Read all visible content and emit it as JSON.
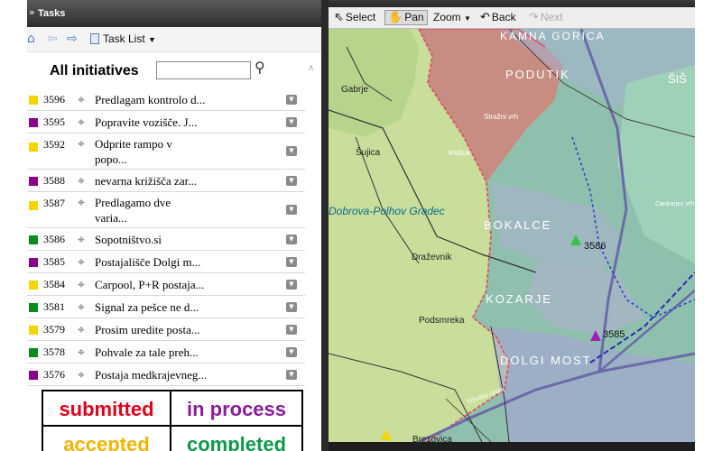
{
  "panel": {
    "title": "Tasks"
  },
  "toolbar": {
    "tasklist_label": "Task List"
  },
  "heading": "All initiatives",
  "search": {
    "value": ""
  },
  "tasks": [
    {
      "id": "3596",
      "text": "Predlagam kontrolo d...",
      "color": "#f3d500"
    },
    {
      "id": "3595",
      "text": "Popravite vozišče. J...",
      "color": "#8a008a"
    },
    {
      "id": "3592",
      "text": "Odprite rampo v popo...",
      "color": "#f3d500"
    },
    {
      "id": "3588",
      "text": "nevarna križišča zar...",
      "color": "#8a008a"
    },
    {
      "id": "3587",
      "text": "Predlagamo dve varia...",
      "color": "#f3d500"
    },
    {
      "id": "3586",
      "text": "Sopotništvo.si",
      "color": "#0a8a1a"
    },
    {
      "id": "3585",
      "text": "Postajališče Dolgi m...",
      "color": "#8a008a"
    },
    {
      "id": "3584",
      "text": "Carpool, P+R postaja...",
      "color": "#f3d500"
    },
    {
      "id": "3581",
      "text": "Signal za pešce ne d...",
      "color": "#0a8a1a"
    },
    {
      "id": "3579",
      "text": "Prosim uredite posta...",
      "color": "#f3d500"
    },
    {
      "id": "3578",
      "text": "Pohvale za tale preh...",
      "color": "#0a8a1a"
    },
    {
      "id": "3576",
      "text": "Postaja medkrajevneg...",
      "color": "#8a008a"
    }
  ],
  "legend": {
    "submitted": {
      "label": "submitted",
      "color": "#e0001a"
    },
    "in_process": {
      "label": "in process",
      "color": "#8a1b9a"
    },
    "accepted": {
      "label": "accepted",
      "color": "#f2b400"
    },
    "completed": {
      "label": "completed",
      "color": "#0a9a4a"
    }
  },
  "map_toolbar": {
    "select": "Select",
    "pan": "Pan",
    "zoom": "Zoom",
    "back": "Back",
    "next": "Next"
  },
  "map": {
    "labels": {
      "kamna_gorica": "KAMNA GORICA",
      "podutik": "PODUTIK",
      "sis": "ŠIŠ",
      "gabrje": "Gabrje",
      "sujica": "Šujica",
      "strazni_vrh": "Stražni vrh",
      "klobuk": "Klobuk",
      "dobrova": "Dobrova-Polhov Gradec",
      "bokalce": "BOKALCE",
      "drazevnik": "Draževnik",
      "kozarje": "KOZARJE",
      "podsmreka": "Podsmreka",
      "dolgi_most": "DOLGI MOST",
      "brezovica": "Brezovica",
      "trzaska": "Tržaška cesta",
      "cankarjev": "Cankarjev vrh",
      "marker_3586": "3586",
      "marker_3585": "3585"
    }
  }
}
